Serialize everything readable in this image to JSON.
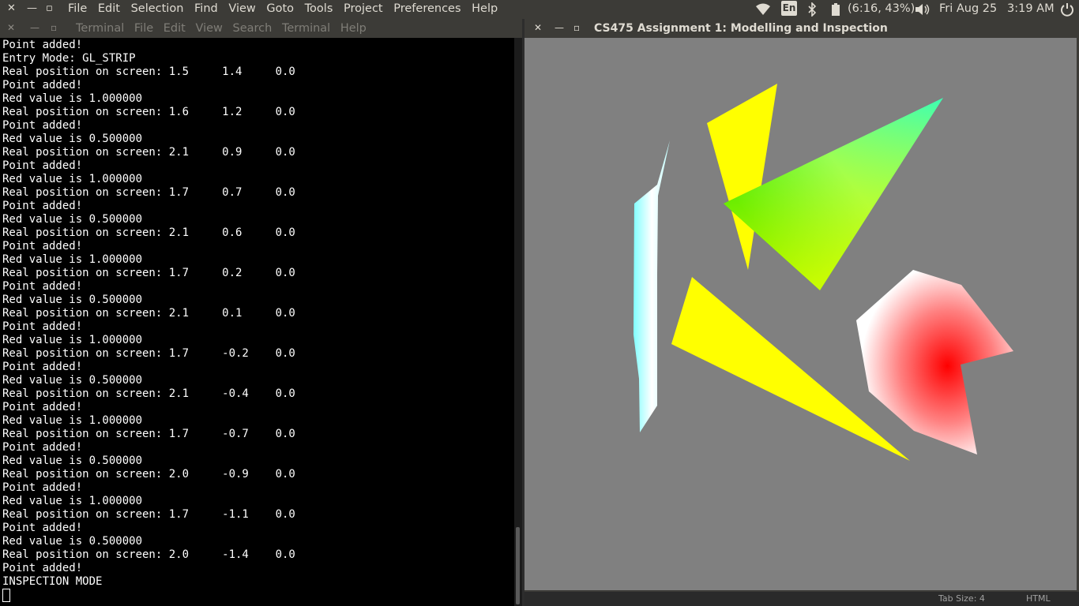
{
  "top_panel": {
    "menu": [
      "File",
      "Edit",
      "Selection",
      "Find",
      "View",
      "Goto",
      "Tools",
      "Project",
      "Preferences",
      "Help"
    ],
    "keyboard_layout": "En",
    "battery": "(6:16, 43%)",
    "date": "Fri Aug 25",
    "time": "3:19 AM"
  },
  "terminal": {
    "menu": [
      "Terminal",
      "File",
      "Edit",
      "View",
      "Search",
      "Terminal",
      "Help"
    ],
    "lines": [
      "Point added!",
      "Entry Mode: GL_STRIP",
      "Real position on screen: 1.5     1.4     0.0",
      "Point added!",
      "Red value is 1.000000",
      "Real position on screen: 1.6     1.2     0.0",
      "Point added!",
      "Red value is 0.500000",
      "Real position on screen: 2.1     0.9     0.0",
      "Point added!",
      "Red value is 1.000000",
      "Real position on screen: 1.7     0.7     0.0",
      "Point added!",
      "Red value is 0.500000",
      "Real position on screen: 2.1     0.6     0.0",
      "Point added!",
      "Red value is 1.000000",
      "Real position on screen: 1.7     0.2     0.0",
      "Point added!",
      "Red value is 0.500000",
      "Real position on screen: 2.1     0.1     0.0",
      "Point added!",
      "Red value is 1.000000",
      "Real position on screen: 1.7     -0.2    0.0",
      "Point added!",
      "Red value is 0.500000",
      "Real position on screen: 2.1     -0.4    0.0",
      "Point added!",
      "Red value is 1.000000",
      "Real position on screen: 1.7     -0.7    0.0",
      "Point added!",
      "Red value is 0.500000",
      "Real position on screen: 2.0     -0.9    0.0",
      "Point added!",
      "Red value is 1.000000",
      "Real position on screen: 1.7     -1.1    0.0",
      "Point added!",
      "Red value is 0.500000",
      "Real position on screen: 2.0     -1.4    0.0",
      "Point added!",
      "INSPECTION MODE"
    ]
  },
  "gl_window": {
    "title": "CS475 Assignment 1: Modelling and Inspection",
    "background_color": "#808080",
    "shapes": [
      {
        "name": "white-cyan-strip",
        "colors": [
          "#ffffff",
          "#80ffff"
        ]
      },
      {
        "name": "yellow-thin-triangle",
        "colors": [
          "#ffff00"
        ]
      },
      {
        "name": "green-cyan-triangle",
        "colors": [
          "#00ff00",
          "#00ffff",
          "#ffff00"
        ]
      },
      {
        "name": "yellow-large-triangle",
        "colors": [
          "#ffff00"
        ]
      },
      {
        "name": "red-white-polygon",
        "colors": [
          "#ff0000",
          "#ffffff"
        ]
      }
    ]
  },
  "status_bar": {
    "tab_size": "Tab Size: 4",
    "syntax": "HTML"
  }
}
